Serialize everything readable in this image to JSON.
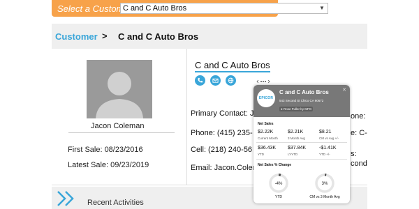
{
  "topbar": {
    "selector_label": "Select a Customer:",
    "selected_customer": "C and C Auto Bros",
    "caret_icon": "chevron-down-icon"
  },
  "breadcrumb": {
    "customer": "Customer",
    "separator": ">",
    "current": "C and C Auto Bros"
  },
  "contact": {
    "name": "Jacon Coleman",
    "first_sale": "First Sale: 08/23/2016",
    "latest_sale": "Latest Sale: 09/23/2019"
  },
  "main": {
    "title": "C and C Auto Bros",
    "actions": [
      {
        "icon": "phone-icon"
      },
      {
        "icon": "email-icon"
      },
      {
        "icon": "globe-icon"
      }
    ],
    "primary_contact": "Primary Contact: J",
    "phone": "Phone: (415) 235-",
    "cell": "Cell: (218) 240-56",
    "email": "Email: Jacon.Coler",
    "right_col": [
      "one:",
      "e: C-",
      "s:",
      "cond"
    ]
  },
  "recent": {
    "label": "Recent Activities",
    "chevron_icon": "double-chevron-right-icon"
  },
  "card": {
    "name": "C and C Auto Bros",
    "address": "543 Second St Chico CA 90672",
    "rep": "Rose Fuller by MFG",
    "logo_text": "EPICOR",
    "close": "✕",
    "net_sales_title": "Net Sales",
    "net_sales": [
      {
        "value": "$2.22K",
        "label": "Current Month"
      },
      {
        "value": "$2.21K",
        "label": "3 Month Avg"
      },
      {
        "value": "$8.21",
        "label": "CM vs Avg +/-"
      },
      {
        "value": "$36.43K",
        "label": "YTD"
      },
      {
        "value": "$37.84K",
        "label": "LYYTD"
      },
      {
        "value": "-$1.41K",
        "label": "YTD +/-"
      }
    ],
    "change_title": "Net Sales % Change",
    "donuts": [
      {
        "value": "-4%",
        "label": "YTD",
        "fraction": 0.04
      },
      {
        "value": "3%",
        "label": "CM vs 3 Month Avg",
        "fraction": 0.03
      }
    ]
  },
  "colors": {
    "accent": "#3aa6d9",
    "selector": "#f7a24a",
    "card_header": "#787878"
  }
}
